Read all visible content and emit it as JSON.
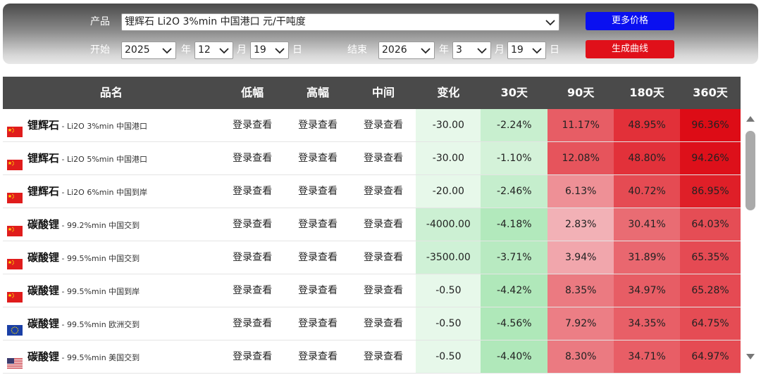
{
  "filter": {
    "product_label": "产品",
    "product_value": "锂辉石 Li2O 3%min 中国港口 元/干吨度",
    "start_label": "开始",
    "end_label": "结束",
    "year_unit": "年",
    "month_unit": "月",
    "day_unit": "日",
    "start_year": "2025",
    "start_month": "12",
    "start_day": "19",
    "end_year": "2026",
    "end_month": "3",
    "end_day": "19",
    "more_price_button": "更多价格",
    "generate_curve_button": "生成曲线"
  },
  "colors": {
    "more_button": "#0a10f0",
    "generate_button": "#e0101a",
    "header_bg": "#4a4a4a"
  },
  "table": {
    "headers": [
      "品名",
      "低幅",
      "高幅",
      "中间",
      "变化",
      "30天",
      "90天",
      "180天",
      "360天"
    ],
    "rows": [
      {
        "flag": "china-flag-icon",
        "name": "锂辉石",
        "spec": " - Li2O 3%min 中国港口",
        "low": "登录查看",
        "high": "登录查看",
        "mid": "登录查看",
        "change": "-30.00",
        "d30": "-2.24%",
        "d90": "11.17%",
        "d180": "48.95%",
        "d360": "96.36%"
      },
      {
        "flag": "china-flag-icon",
        "name": "锂辉石",
        "spec": " - Li2O 5%min 中国港口",
        "low": "登录查看",
        "high": "登录查看",
        "mid": "登录查看",
        "change": "-30.00",
        "d30": "-1.10%",
        "d90": "12.08%",
        "d180": "48.80%",
        "d360": "94.26%"
      },
      {
        "flag": "china-flag-icon",
        "name": "锂辉石",
        "spec": " - Li2O 6%min 中国到岸",
        "low": "登录查看",
        "high": "登录查看",
        "mid": "登录查看",
        "change": "-20.00",
        "d30": "-2.46%",
        "d90": "6.13%",
        "d180": "40.72%",
        "d360": "86.95%"
      },
      {
        "flag": "china-flag-icon",
        "name": "碳酸锂",
        "spec": " - 99.2%min 中国交到",
        "low": "登录查看",
        "high": "登录查看",
        "mid": "登录查看",
        "change": "-4000.00",
        "d30": "-4.18%",
        "d90": "2.83%",
        "d180": "30.41%",
        "d360": "64.03%"
      },
      {
        "flag": "china-flag-icon",
        "name": "碳酸锂",
        "spec": " - 99.5%min 中国交到",
        "low": "登录查看",
        "high": "登录查看",
        "mid": "登录查看",
        "change": "-3500.00",
        "d30": "-3.71%",
        "d90": "3.94%",
        "d180": "31.89%",
        "d360": "65.35%"
      },
      {
        "flag": "china-flag-icon",
        "name": "碳酸锂",
        "spec": " - 99.5%min 中国到岸",
        "low": "登录查看",
        "high": "登录查看",
        "mid": "登录查看",
        "change": "-0.50",
        "d30": "-4.42%",
        "d90": "8.35%",
        "d180": "34.97%",
        "d360": "65.28%"
      },
      {
        "flag": "eu-flag-icon",
        "name": "碳酸锂",
        "spec": " - 99.5%min 欧洲交到",
        "low": "登录查看",
        "high": "登录查看",
        "mid": "登录查看",
        "change": "-0.50",
        "d30": "-4.56%",
        "d90": "7.92%",
        "d180": "34.35%",
        "d360": "64.75%"
      },
      {
        "flag": "us-flag-icon",
        "name": "碳酸锂",
        "spec": " - 99.5%min 美国交到",
        "low": "登录查看",
        "high": "登录查看",
        "mid": "登录查看",
        "change": "-0.50",
        "d30": "-4.40%",
        "d90": "8.30%",
        "d180": "34.71%",
        "d360": "64.97%"
      }
    ]
  }
}
